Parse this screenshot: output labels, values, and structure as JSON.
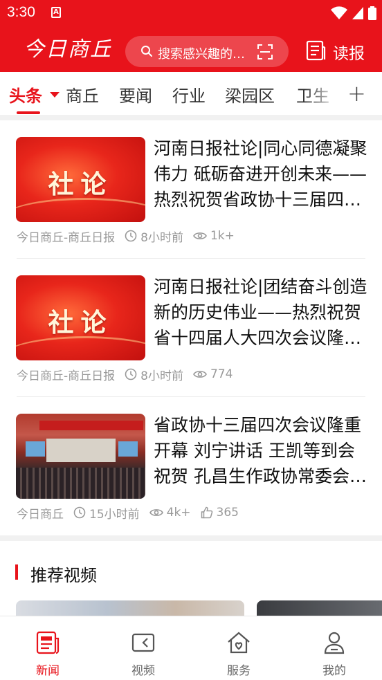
{
  "status_bar": {
    "time": "3:30",
    "notification_badge": "A"
  },
  "header": {
    "logo_text": "今日商丘",
    "search_placeholder": "搜索感兴趣的内容",
    "read_label": "读报"
  },
  "tabs": [
    {
      "label": "头条",
      "active": true
    },
    {
      "label": "商丘"
    },
    {
      "label": "要闻"
    },
    {
      "label": "行业"
    },
    {
      "label": "梁园区"
    },
    {
      "label": "卫生"
    }
  ],
  "news": [
    {
      "thumb_label": "社论",
      "title": "河南日报社论|同心同德凝聚伟力 砥砺奋进开创未来——热烈祝贺省政协十三届四次会议隆重开幕",
      "source": "今日商丘-商丘日报",
      "time": "8小时前",
      "views": "1k+"
    },
    {
      "thumb_label": "社论",
      "title": "河南日报社论|团结奋斗创造新的历史伟业——热烈祝贺省十四届人大四次会议隆重开幕",
      "source": "今日商丘-商丘日报",
      "time": "8小时前",
      "views": "774"
    },
    {
      "title": "省政协十三届四次会议隆重开幕 刘宁讲话 王凯等到会祝贺 孔昌生作政协常委会工作报告",
      "source": "今日商丘",
      "time": "15小时前",
      "views": "4k+",
      "likes": "365"
    }
  ],
  "recommended": {
    "title": "推荐视频"
  },
  "bottom_nav": [
    {
      "label": "新闻",
      "icon": "news-icon",
      "active": true
    },
    {
      "label": "视频",
      "icon": "video-icon"
    },
    {
      "label": "服务",
      "icon": "service-icon"
    },
    {
      "label": "我的",
      "icon": "profile-icon"
    }
  ],
  "colors": {
    "brand_red": "#e8131b",
    "meta_gray": "#999999"
  }
}
